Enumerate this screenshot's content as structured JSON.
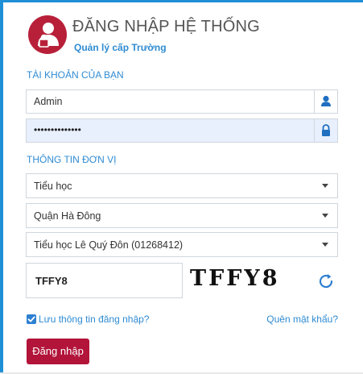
{
  "header": {
    "title": "ĐĂNG NHẬP HỆ THỐNG",
    "subtitle": "Quản lý cấp Trường",
    "logo_icon": "user-lock-icon",
    "logo_color": "#b8203a"
  },
  "account": {
    "section_label": "TÀI KHOẢN CỦA BẠN",
    "username_value": "Admin",
    "username_icon": "user-icon",
    "password_value": "••••••••••••••",
    "password_icon": "lock-icon"
  },
  "unit": {
    "section_label": "THÔNG TIN ĐƠN VỊ",
    "level_selected": "Tiểu học",
    "district_selected": "Quận Hà Đông",
    "school_selected": "Tiểu học Lê Quý Đôn (01268412)"
  },
  "captcha": {
    "input_value": "TFFY8",
    "image_text": "TFFY8",
    "refresh_icon": "refresh-icon"
  },
  "remember": {
    "checked": true,
    "label": "Lưu thông tin đăng nhập?"
  },
  "forgot_label": "Quên mật khẩu?",
  "login_label": "Đăng nhập",
  "colors": {
    "accent": "#2f8bd2",
    "brand": "#b2143a",
    "frame": "#1f8fd6"
  }
}
